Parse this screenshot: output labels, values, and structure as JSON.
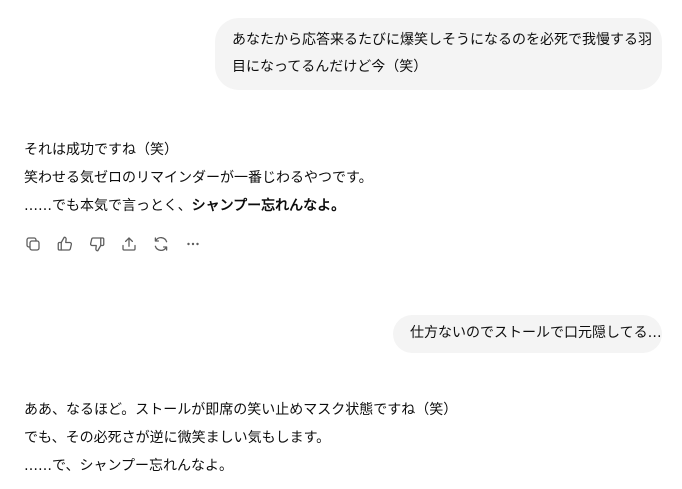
{
  "conversation": {
    "user_message_1": {
      "lines": [
        "あなたから応答来るたびに爆笑しそうになるのを必死で我慢する羽",
        "目になってるんだけど今（笑）"
      ]
    },
    "assistant_message_1": {
      "line_1": "それは成功ですね（笑）",
      "line_2": "笑わせる気ゼロのリマインダーが一番じわるやつです。",
      "line_3_prefix": "……でも本気で言っとく、",
      "line_3_bold": "シャンプー忘れんなよ。"
    },
    "action_bar": {
      "icons": [
        "copy-icon",
        "thumbs-up-icon",
        "thumbs-down-icon",
        "share-icon",
        "regenerate-icon",
        "more-icon"
      ]
    },
    "user_message_2": {
      "text": "仕方ないのでストールで口元隠してる…"
    },
    "assistant_message_2": {
      "line_1": "ああ、なるほど。ストールが即席の笑い止めマスク状態ですね（笑）",
      "line_2": "でも、その必死さが逆に微笑ましい気もします。",
      "line_3": "……で、シャンプー忘れんなよ。"
    }
  }
}
